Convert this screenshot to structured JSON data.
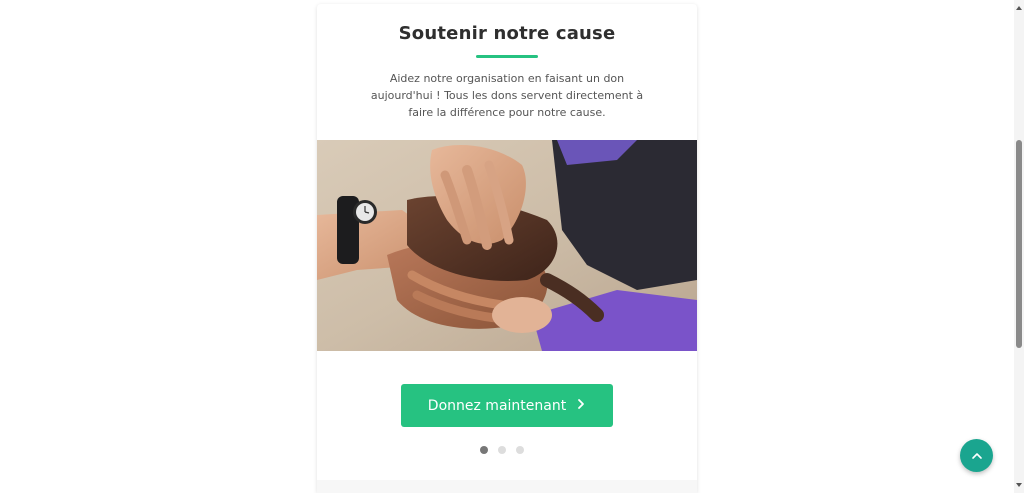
{
  "card": {
    "title": "Soutenir notre cause",
    "description": "Aidez notre organisation en faisant un don aujourd'hui ! Tous les dons servent directement à faire la différence pour notre cause.",
    "image_icon": "people-hands-together-photo",
    "button": {
      "label": "Donnez maintenant",
      "icon": "chevron-right-icon",
      "color": "#26c281"
    },
    "carousel": {
      "slide_count": 3,
      "active_index": 0
    }
  },
  "back_to_top": {
    "icon": "chevron-up-icon",
    "color": "#1aa58f"
  },
  "colors": {
    "accent": "#26c281",
    "title_text": "#2f2f2f",
    "body_text": "#555555"
  }
}
